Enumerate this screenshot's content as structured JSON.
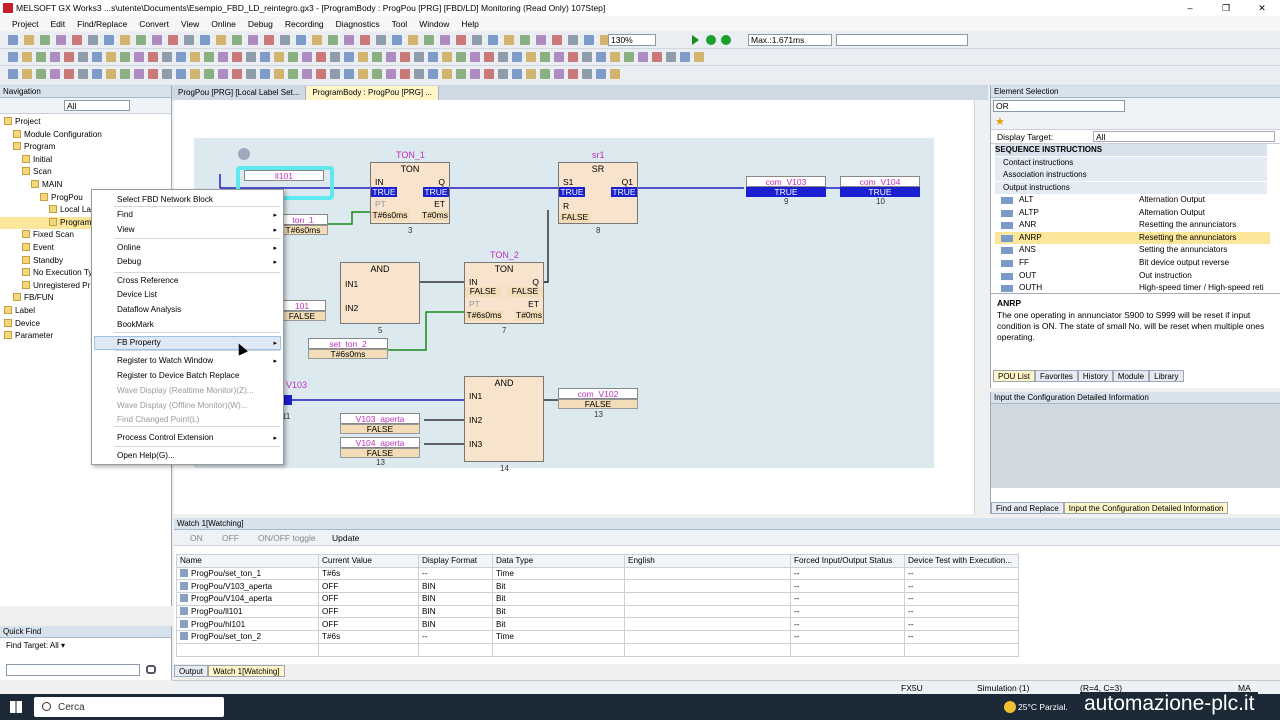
{
  "window": {
    "title": "MELSOFT GX Works3 ...s\\utente\\Documents\\Esempio_FBD_LD_reintegro.gx3 - [ProgramBody : ProgPou [PRG] [FBD/LD] Monitoring (Read Only) 107Step]",
    "minimize": "–",
    "restore": "❐",
    "close": "✕"
  },
  "menu": [
    "Project",
    "Edit",
    "Find/Replace",
    "Convert",
    "View",
    "Online",
    "Debug",
    "Recording",
    "Diagnostics",
    "Tool",
    "Window",
    "Help"
  ],
  "toolbar": {
    "zoom": "130%",
    "scan_time": "Max.:1.671ms"
  },
  "navigation": {
    "title": "Navigation",
    "filter": "All",
    "items": [
      {
        "label": "Project",
        "indent": 0
      },
      {
        "label": "Module Configuration",
        "indent": 1
      },
      {
        "label": "Program",
        "indent": 1
      },
      {
        "label": "Initial",
        "indent": 2
      },
      {
        "label": "Scan",
        "indent": 2
      },
      {
        "label": "MAIN",
        "indent": 3
      },
      {
        "label": "ProgPou",
        "indent": 4
      },
      {
        "label": "Local La",
        "indent": 5
      },
      {
        "label": "Program",
        "indent": 5
      },
      {
        "label": "Fixed Scan",
        "indent": 2
      },
      {
        "label": "Event",
        "indent": 2
      },
      {
        "label": "Standby",
        "indent": 2
      },
      {
        "label": "No Execution Ty",
        "indent": 2
      },
      {
        "label": "Unregistered Pr",
        "indent": 2
      },
      {
        "label": "FB/FUN",
        "indent": 1
      },
      {
        "label": "Label",
        "indent": 0
      },
      {
        "label": "Device",
        "indent": 0
      },
      {
        "label": "Parameter",
        "indent": 0
      }
    ]
  },
  "quick_find": {
    "title": "Quick Find",
    "find_target": "Find Target: All ▾"
  },
  "editor_tabs": [
    {
      "label": "ProgPou [PRG] [Local Label Set..."
    },
    {
      "label": "ProgramBody : ProgPou [PRG] ..."
    }
  ],
  "fbd": {
    "inst_ton1": "TON_1",
    "inst_sr1": "sr1",
    "inst_ton2": "TON_2",
    "ton": "TON",
    "sr": "SR",
    "and": "AND",
    "pin_in": "IN",
    "pin_q": "Q",
    "pin_pt": "PT",
    "pin_et": "ET",
    "pin_s1": "S1",
    "pin_q1": "Q1",
    "pin_r": "R",
    "pin_in1": "IN1",
    "pin_in2": "IN2",
    "pin_in3": "IN3",
    "var_ll101": "ll101",
    "var_ton1": "ton_1",
    "val_t6s0ms": "T#6s0ms",
    "val_t0ms": "T#0ms",
    "var_com103": "com_V103",
    "var_com104": "com_V104",
    "var_101": "101",
    "var_set_ton2": "set_ton_2",
    "var_v103": "V103",
    "var_v103a": "V103_aperta",
    "var_v104a": "V104_aperta",
    "var_com102": "com_V102",
    "true": "TRUE",
    "false": "FALSE",
    "n3": "3",
    "n5": "5",
    "n7": "7",
    "n8": "8",
    "n9": "9",
    "n10": "10",
    "n11": "11",
    "n13": "13",
    "n14": "14"
  },
  "context_menu": [
    {
      "label": "Select FBD Network Block",
      "sub": false,
      "dis": false
    },
    {
      "label": "Find",
      "sub": true,
      "dis": false
    },
    {
      "label": "View",
      "sub": true,
      "dis": false
    },
    {
      "label": "Online",
      "sub": true,
      "dis": false
    },
    {
      "label": "Debug",
      "sub": true,
      "dis": false
    },
    {
      "label": "Cross Reference",
      "sub": false,
      "dis": false
    },
    {
      "label": "Device List",
      "sub": false,
      "dis": false
    },
    {
      "label": "Dataflow Analysis",
      "sub": false,
      "dis": false
    },
    {
      "label": "BookMark",
      "sub": false,
      "dis": false
    },
    {
      "label": "FB Property",
      "sub": true,
      "dis": false
    },
    {
      "label": "Register to Watch Window",
      "sub": true,
      "dis": false
    },
    {
      "label": "Register to Device Batch Replace",
      "sub": false,
      "dis": false
    },
    {
      "label": "Wave Display (Realtime Monitor)(Z)...",
      "sub": false,
      "dis": true
    },
    {
      "label": "Wave Display (Offline Monitor)(W)...",
      "sub": false,
      "dis": true
    },
    {
      "label": "Find Changed Point(L)",
      "sub": false,
      "dis": true
    },
    {
      "label": "Process Control Extension",
      "sub": true,
      "dis": false
    },
    {
      "label": "Open Help(G)...",
      "sub": false,
      "dis": false
    }
  ],
  "element_selection": {
    "title": "Element Selection",
    "search": "OR",
    "display_target_label": "Display Target:",
    "display_target": "All",
    "categories": [
      "SEQUENCE INSTRUCTIONS",
      "Contact instructions",
      "Association instructions",
      "Output instructions"
    ],
    "rows": [
      {
        "name": "ALT",
        "desc": "Alternation Output"
      },
      {
        "name": "ALTP",
        "desc": "Alternation Output"
      },
      {
        "name": "ANR",
        "desc": "Resetting the annunciators"
      },
      {
        "name": "ANRP",
        "desc": "Resetting the annunciators"
      },
      {
        "name": "ANS",
        "desc": "Setting the annunciators"
      },
      {
        "name": "FF",
        "desc": "Bit device output reverse"
      },
      {
        "name": "OUT",
        "desc": "Out instruction"
      },
      {
        "name": "OUTH",
        "desc": "High-speed timer / High-speed reti"
      }
    ],
    "sel_name": "ANRP",
    "sel_desc": "The one operating in annunciator S900 to S999 will be reset if input condition is ON. The state of small No. will be reset when multiple ones operating.",
    "tabs": [
      "POU List",
      "Favorites",
      "History",
      "Module",
      "Library"
    ]
  },
  "config": {
    "title": "Input the Configuration Detailed Information",
    "tabs": [
      "Find and Replace",
      "Input the Configuration Detailed Information"
    ]
  },
  "watch": {
    "title": "Watch 1[Watching]",
    "btn_on": "ON",
    "btn_off": "OFF",
    "btn_toggle": "ON/OFF toggle",
    "btn_update": "Update",
    "headers": [
      "Name",
      "Current Value",
      "Display Format",
      "Data Type",
      "English",
      "Forced Input/Output Status",
      "Device Test with Execution..."
    ],
    "rows": [
      [
        "ProgPou/set_ton_1",
        "T#6s",
        "--",
        "Time",
        "",
        "--",
        "--"
      ],
      [
        "ProgPou/V103_aperta",
        "OFF",
        "BIN",
        "Bit",
        "",
        "--",
        "--"
      ],
      [
        "ProgPou/V104_aperta",
        "OFF",
        "BIN",
        "Bit",
        "",
        "--",
        "--"
      ],
      [
        "ProgPou/ll101",
        "OFF",
        "BIN",
        "Bit",
        "",
        "--",
        "--"
      ],
      [
        "ProgPou/hl101",
        "OFF",
        "BIN",
        "Bit",
        "",
        "--",
        "--"
      ],
      [
        "ProgPou/set_ton_2",
        "T#6s",
        "--",
        "Time",
        "",
        "--",
        "--"
      ]
    ]
  },
  "bottom_tabs": [
    "Output",
    "Watch 1[Watching]"
  ],
  "status": {
    "plc": "FX5U",
    "mode": "Simulation (1)",
    "pos": "(R=4, C=3)",
    "ime": "MA"
  },
  "taskbar": {
    "search": "Cerca",
    "weather": "25°C  Parzial.",
    "watermark": "automazione-plc.it"
  }
}
